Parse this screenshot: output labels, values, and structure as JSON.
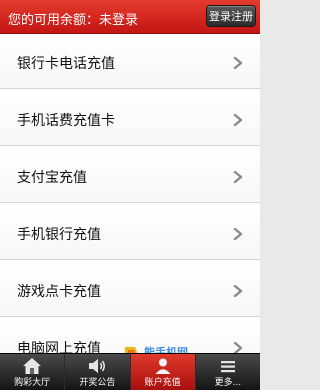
{
  "header": {
    "balance_text": "您的可用余额：未登录",
    "login_button_label": "登录注册"
  },
  "menu": {
    "items": [
      {
        "label": "银行卡电话充值"
      },
      {
        "label": "手机话费充值卡"
      },
      {
        "label": "支付宝充值"
      },
      {
        "label": "手机银行充值"
      },
      {
        "label": "游戏点卡充值"
      },
      {
        "label": "电脑网上充值"
      }
    ],
    "chevron_icon": "chevron-right-icon"
  },
  "tabbar": {
    "tabs": [
      {
        "label": "购彩大厅",
        "icon": "house-icon",
        "active": false
      },
      {
        "label": "开奖公告",
        "icon": "speaker-icon",
        "active": false
      },
      {
        "label": "账户充值",
        "icon": "account-icon",
        "active": true
      },
      {
        "label": "更多...",
        "icon": "more-icon",
        "active": false
      }
    ]
  },
  "watermark": {
    "title": "能手机网",
    "url": "TOMPDA.COM"
  },
  "colors": {
    "header_red": "#d02a1f",
    "active_tab_red": "#c8241b",
    "tabbar_dark": "#2a2a2a",
    "watermark_blue": "#3a8de0"
  }
}
